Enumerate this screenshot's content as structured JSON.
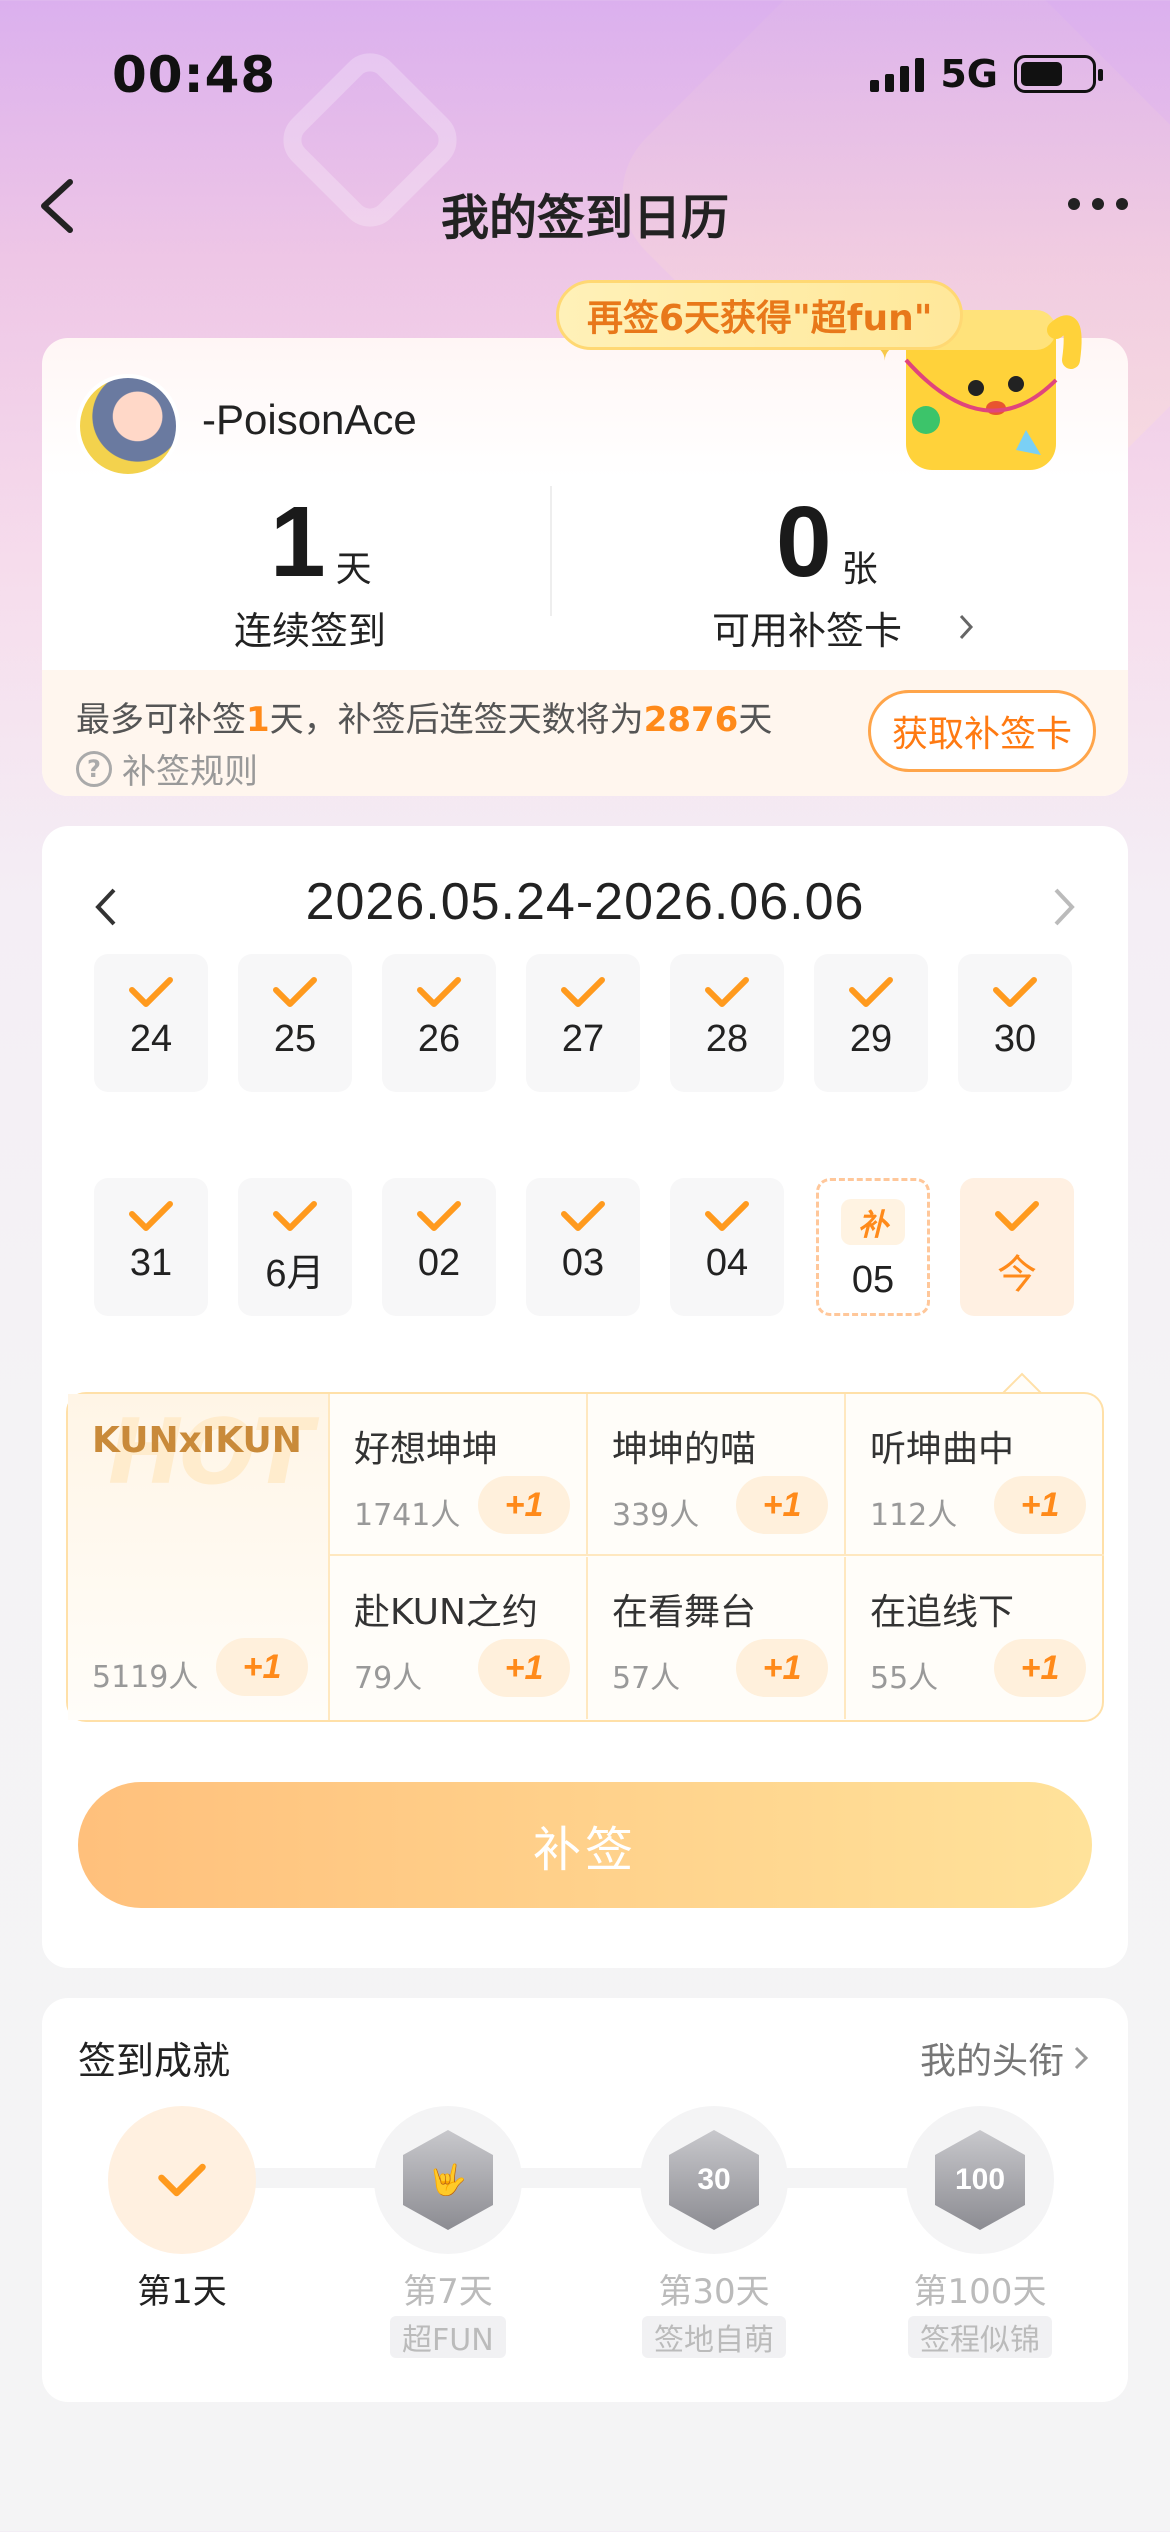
{
  "status_bar": {
    "time": "00:48",
    "network": "5G"
  },
  "header": {
    "title": "我的签到日历"
  },
  "promo": {
    "text": "再签6天获得\"超fun\""
  },
  "user": {
    "name": "-PoisonAce"
  },
  "stats": {
    "streak": {
      "value": "1",
      "unit": "天",
      "label": "连续签到"
    },
    "cards": {
      "value": "0",
      "unit": "张",
      "label": "可用补签卡"
    }
  },
  "makeup": {
    "text_prefix": "最多可补签",
    "max_days": "1",
    "text_mid": "天，补签后连签天数将为",
    "after_days": "2876",
    "text_suffix": "天",
    "rules_label": "补签规则",
    "get_card_label": "获取补签卡"
  },
  "calendar": {
    "range": "2026.05.24-2026.06.06",
    "week1": [
      "24",
      "25",
      "26",
      "27",
      "28",
      "29",
      "30"
    ],
    "week2": [
      "31",
      "6月",
      "02",
      "03",
      "04"
    ],
    "makeup_day": {
      "tag": "补",
      "num": "05"
    },
    "today": {
      "label": "今"
    }
  },
  "topics": {
    "hot": {
      "watermark": "HOT",
      "title": "KUNxIKUN",
      "count": "5119人",
      "plus": "+1"
    },
    "items": [
      {
        "title": "好想坤坤",
        "count": "1741人",
        "plus": "+1"
      },
      {
        "title": "坤坤的喵",
        "count": "339人",
        "plus": "+1"
      },
      {
        "title": "听坤曲中",
        "count": "112人",
        "plus": "+1"
      },
      {
        "title": "赴KUN之约",
        "count": "79人",
        "plus": "+1"
      },
      {
        "title": "在看舞台",
        "count": "57人",
        "plus": "+1"
      },
      {
        "title": "在追线下",
        "count": "55人",
        "plus": "+1"
      }
    ]
  },
  "submit_label": "补签",
  "achievements": {
    "title": "签到成就",
    "link": "我的头衔",
    "items": [
      {
        "day": "第1天",
        "tag": "",
        "badge": ""
      },
      {
        "day": "第7天",
        "tag": "超FUN",
        "badge": "🤟"
      },
      {
        "day": "第30天",
        "tag": "签地自萌",
        "badge": "30"
      },
      {
        "day": "第100天",
        "tag": "签程似锦",
        "badge": "100"
      }
    ]
  },
  "colors": {
    "accent": "#ff8a1a",
    "check": "#ff9a1e",
    "brand_gradient_start": "#ffc07c",
    "brand_gradient_end": "#ffe29a"
  },
  "icons": [
    "back-arrow-icon",
    "more-dots-icon",
    "check-icon",
    "chevron-left-icon",
    "chevron-right-icon",
    "question-icon",
    "mascot-icon"
  ]
}
